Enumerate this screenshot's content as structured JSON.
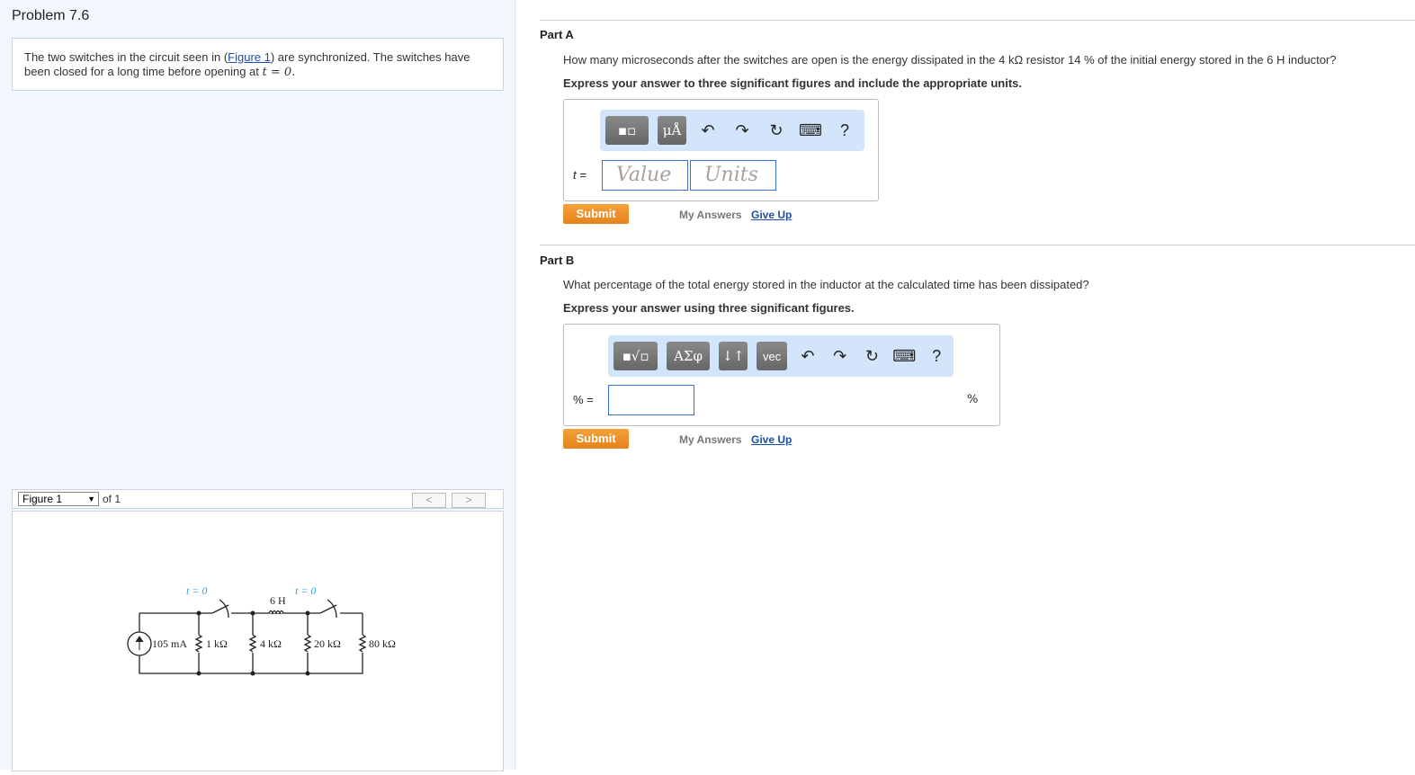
{
  "problem": {
    "title": "Problem 7.6",
    "intro_before": "The two switches in the circuit seen in (",
    "figure_link": "Figure 1",
    "intro_after": ") are synchronized. The switches have been closed for a long time before opening at ",
    "intro_math": "t = 0."
  },
  "figure": {
    "select": "Figure 1",
    "of": "of 1",
    "prev": "<",
    "next": ">",
    "labels": {
      "t0a": "t = 0",
      "t0b": "t = 0",
      "inductor": "6 H",
      "source": "105 mA",
      "r1": "1 kΩ",
      "r2": "4 kΩ",
      "r3": "20 kΩ",
      "r4": "80 kΩ"
    }
  },
  "partA": {
    "title": "Part A",
    "question": "How many microseconds after the switches are open is the energy dissipated in the 4 kΩ resistor 14 % of the initial energy stored in the 6 H inductor?",
    "instruction": "Express your answer to three significant figures and include the appropriate units.",
    "units_btn": "μÅ",
    "help": "?",
    "var_label": "t =",
    "value_placeholder": "Value",
    "units_placeholder": "Units",
    "submit": "Submit",
    "my_answers": "My Answers",
    "give_up": "Give Up"
  },
  "partB": {
    "title": "Part B",
    "question": "What percentage of the total energy stored in the inductor at the calculated time has been dissipated?",
    "instruction": "Express your answer using three significant figures.",
    "greek_btn": "ΑΣφ",
    "arrows_btn": "↓↑",
    "vec_btn": "vec",
    "help": "?",
    "var_label": "% =",
    "unit_suffix": "%",
    "submit": "Submit",
    "my_answers": "My Answers",
    "give_up": "Give Up"
  }
}
